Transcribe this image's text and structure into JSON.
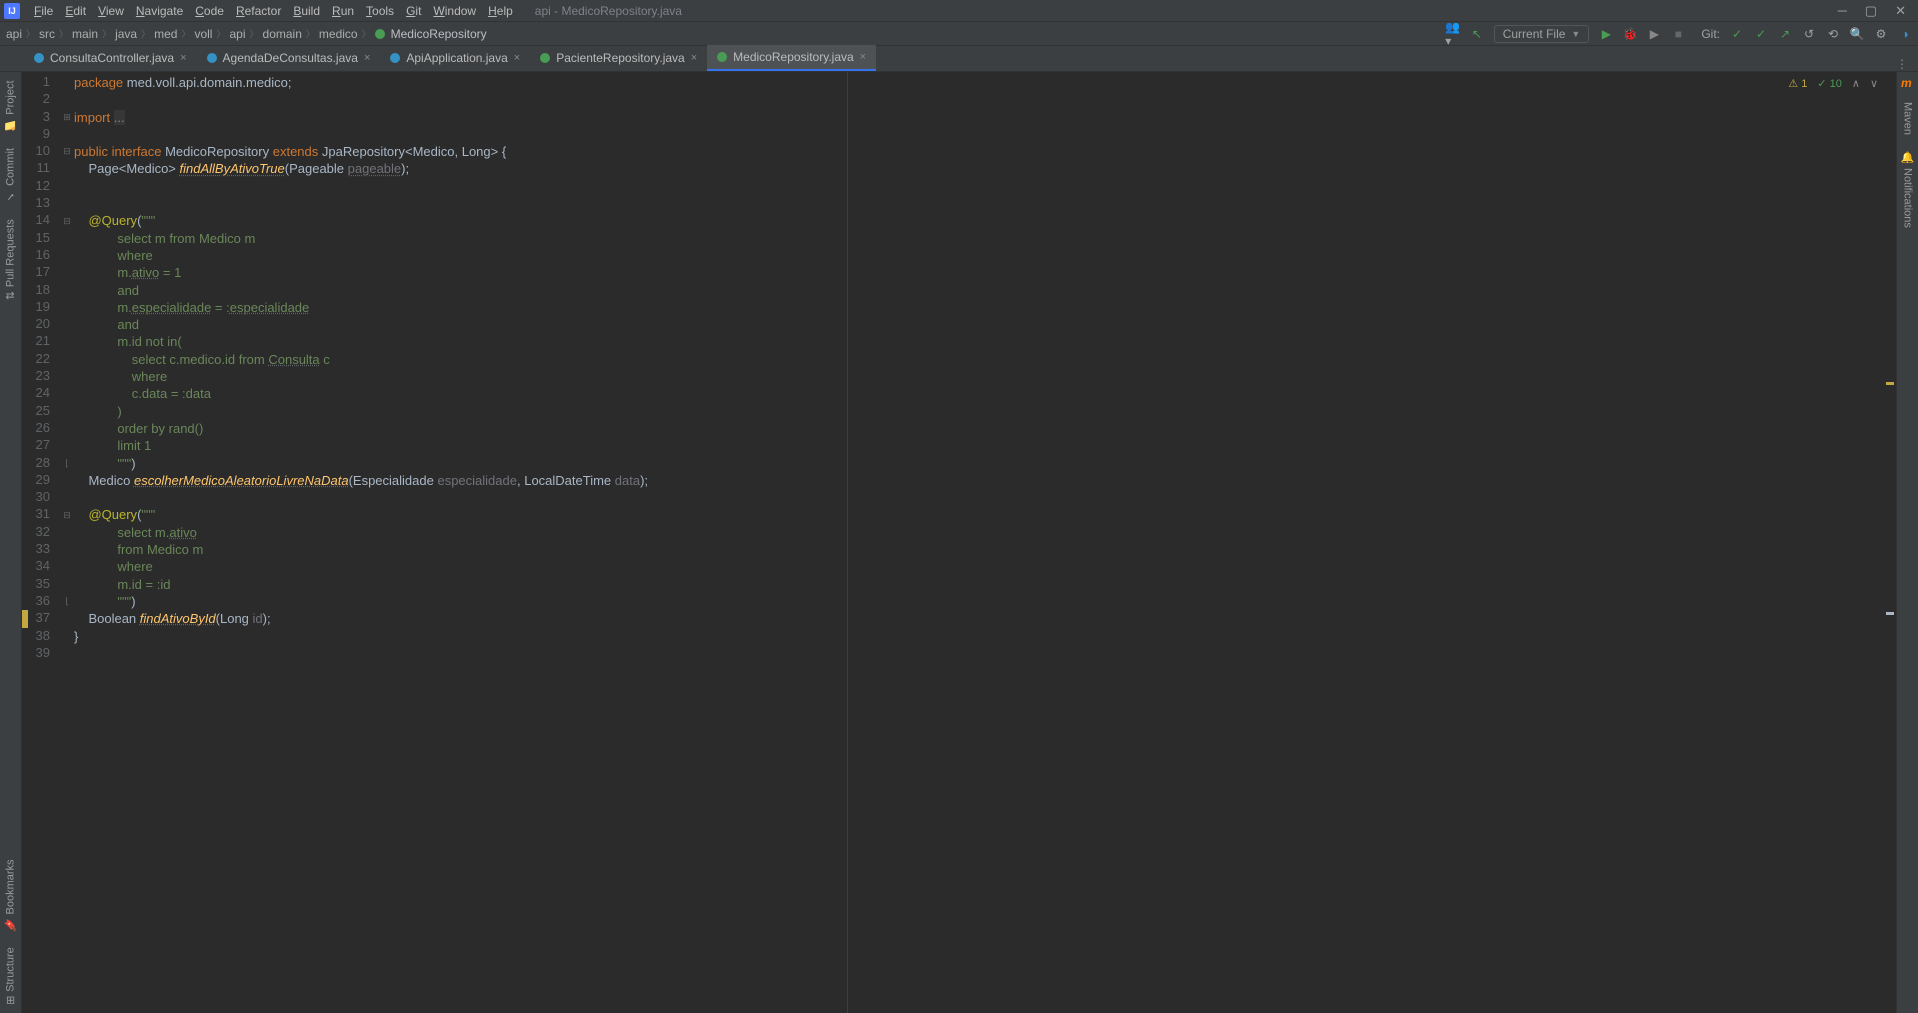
{
  "titlebar": {
    "menu": [
      "File",
      "Edit",
      "View",
      "Navigate",
      "Code",
      "Refactor",
      "Build",
      "Run",
      "Tools",
      "Git",
      "Window",
      "Help"
    ],
    "title": "api - MedicoRepository.java"
  },
  "breadcrumbs": [
    "api",
    "src",
    "main",
    "java",
    "med",
    "voll",
    "api",
    "domain",
    "medico",
    "MedicoRepository"
  ],
  "runconfig": "Current File",
  "git_label": "Git:",
  "tabs": [
    {
      "label": "ConsultaController.java",
      "color": "blue",
      "active": false
    },
    {
      "label": "AgendaDeConsultas.java",
      "color": "blue",
      "active": false
    },
    {
      "label": "ApiApplication.java",
      "color": "blue",
      "active": false
    },
    {
      "label": "PacienteRepository.java",
      "color": "green",
      "active": false
    },
    {
      "label": "MedicoRepository.java",
      "color": "green",
      "active": true
    }
  ],
  "left_tools": [
    "Project",
    "Commit",
    "Pull Requests",
    "Bookmarks",
    "Structure"
  ],
  "right_tools": [
    "Maven",
    "Notifications"
  ],
  "badges": {
    "warnings": "1",
    "ok": "10"
  },
  "code": {
    "lines": [
      {
        "num": "1",
        "html": "<span class='kw'>package</span> med.voll.api.domain.medico;"
      },
      {
        "num": "2",
        "html": ""
      },
      {
        "num": "3",
        "html": "<span class='kw'>import</span> <span style='background:#373737;color:#888'>...</span>"
      },
      {
        "num": "9",
        "html": ""
      },
      {
        "num": "10",
        "html": "<span class='kw'>public interface</span> MedicoRepository <span class='kw'>extends</span> JpaRepository&lt;Medico, Long&gt; {"
      },
      {
        "num": "11",
        "html": "    Page&lt;Medico&gt; <span class='fn under'>findAllByAtivoTrue</span>(Pageable <span class='param under'>pageable</span>);"
      },
      {
        "num": "12",
        "html": ""
      },
      {
        "num": "13",
        "html": ""
      },
      {
        "num": "14",
        "html": "    <span class='ann'>@Query</span>(<span class='str'>\"\"\"</span>"
      },
      {
        "num": "15",
        "html": "<span class='str'>            select m from Medico m</span>"
      },
      {
        "num": "16",
        "html": "<span class='str'>            where</span>"
      },
      {
        "num": "17",
        "html": "<span class='str'>            m.<span class='under'>ativo</span> = 1</span>"
      },
      {
        "num": "18",
        "html": "<span class='str'>            and</span>"
      },
      {
        "num": "19",
        "html": "<span class='str'>            m.<span class='under'>especialidade</span> = :<span class='under'>especialidade</span></span>"
      },
      {
        "num": "20",
        "html": "<span class='str'>            and</span>"
      },
      {
        "num": "21",
        "html": "<span class='str'>            m.id not in(</span>"
      },
      {
        "num": "22",
        "html": "<span class='str'>                select c.medico.id from <span class='under'>Consulta</span> c</span>"
      },
      {
        "num": "23",
        "html": "<span class='str'>                where</span>"
      },
      {
        "num": "24",
        "html": "<span class='str'>                c.data = :data</span>"
      },
      {
        "num": "25",
        "html": "<span class='str'>            )</span>"
      },
      {
        "num": "26",
        "html": "<span class='str'>            order by rand()</span>"
      },
      {
        "num": "27",
        "html": "<span class='str'>            limit 1</span>"
      },
      {
        "num": "28",
        "html": "<span class='str'>            \"\"\"</span>)"
      },
      {
        "num": "29",
        "html": "    Medico <span class='fn under'>escolherMedicoAleatorioLivreNaData</span>(Especialidade <span class='param'>especialidade</span>, LocalDateTime <span class='param'>data</span>);"
      },
      {
        "num": "30",
        "html": ""
      },
      {
        "num": "31",
        "html": "    <span class='ann'>@Query</span>(<span class='str'>\"\"\"</span>"
      },
      {
        "num": "32",
        "html": "<span class='str'>            select m.<span class='under'>ativo</span></span>"
      },
      {
        "num": "33",
        "html": "<span class='str'>            from Medico m</span>"
      },
      {
        "num": "34",
        "html": "<span class='str'>            where</span>"
      },
      {
        "num": "35",
        "html": "<span class='str'>            m.id = :id</span>"
      },
      {
        "num": "36",
        "html": "<span class='str'>            \"\"\"</span>)"
      },
      {
        "num": "37",
        "html": "    Boolean <span class='fn under'>findAtivoById</span>(Long <span class='param'>id</span>);",
        "caret": true
      },
      {
        "num": "38",
        "html": "}"
      },
      {
        "num": "39",
        "html": ""
      }
    ]
  }
}
